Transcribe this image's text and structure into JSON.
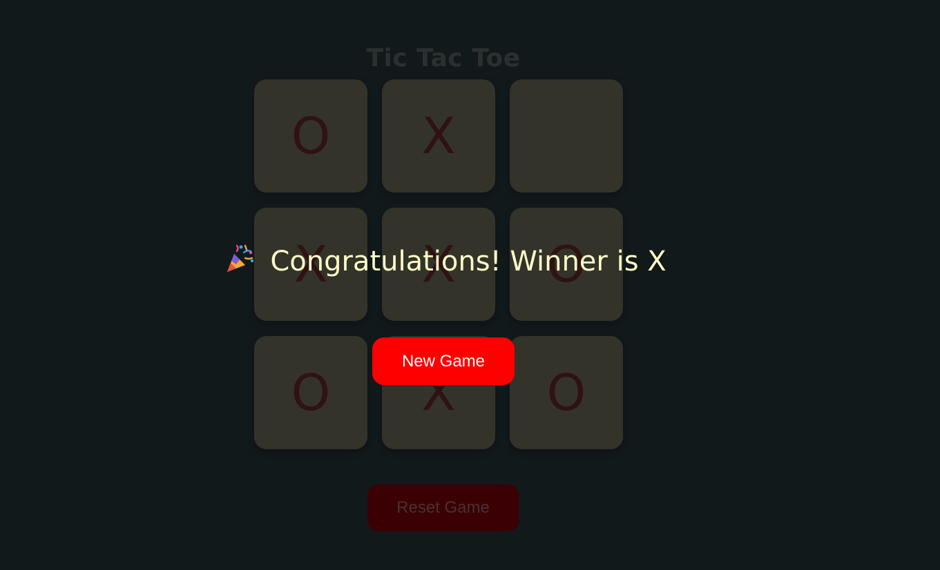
{
  "game": {
    "title": "Tic Tac Toe",
    "board": [
      "O",
      "X",
      "",
      "X",
      "X",
      "O",
      "O",
      "X",
      "O"
    ],
    "reset_label": "Reset Game"
  },
  "result_modal": {
    "icon": "party-popper-icon",
    "message": "Congratulations! Winner is X",
    "new_game_label": "New Game"
  },
  "colors": {
    "background": "#12191b",
    "cell": "#33332a",
    "mark": "#2f1213",
    "message": "#fffcc8",
    "new_game_button": "#ff0000",
    "reset_button": "#3a0003"
  }
}
